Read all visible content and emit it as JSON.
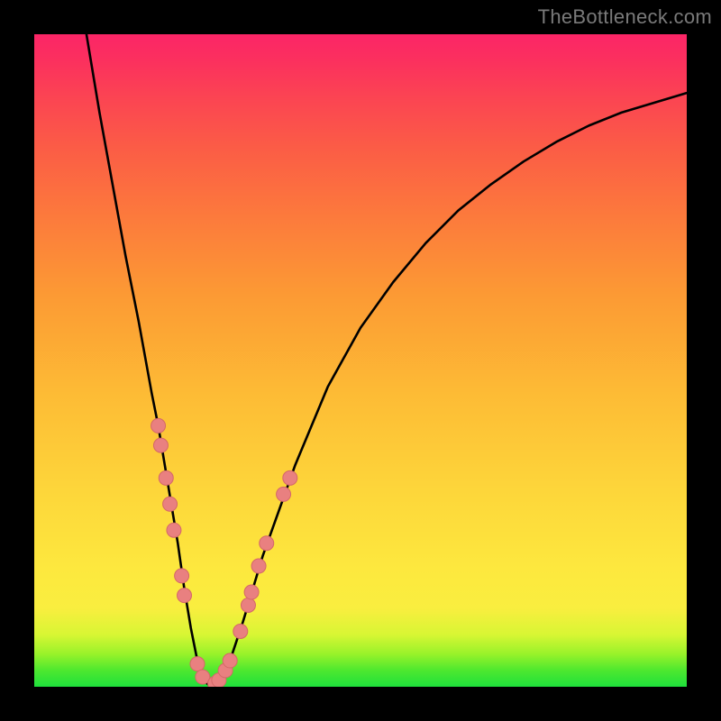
{
  "watermark": "TheBottleneck.com",
  "colors": {
    "frame": "#000000",
    "curve": "#000000",
    "dot_fill": "#e98080",
    "dot_stroke": "#d46868"
  },
  "chart_data": {
    "type": "line",
    "title": "",
    "xlabel": "",
    "ylabel": "",
    "xlim": [
      0,
      100
    ],
    "ylim": [
      0,
      100
    ],
    "series": [
      {
        "name": "curve",
        "x": [
          8,
          10,
          12,
          14,
          16,
          18,
          19,
          20,
          21,
          22,
          23,
          24,
          25,
          26,
          27,
          28,
          30,
          32,
          35,
          40,
          45,
          50,
          55,
          60,
          65,
          70,
          75,
          80,
          85,
          90,
          95,
          100
        ],
        "values": [
          100,
          88,
          77,
          66,
          56,
          45,
          40,
          34,
          28,
          22,
          15,
          9,
          4,
          1,
          0,
          0.5,
          4,
          10,
          20,
          34,
          46,
          55,
          62,
          68,
          73,
          77,
          80.5,
          83.5,
          86,
          88,
          89.5,
          91
        ]
      }
    ],
    "points": [
      {
        "x": 19.0,
        "y": 40
      },
      {
        "x": 19.4,
        "y": 37
      },
      {
        "x": 20.2,
        "y": 32
      },
      {
        "x": 20.8,
        "y": 28
      },
      {
        "x": 21.4,
        "y": 24
      },
      {
        "x": 22.6,
        "y": 17
      },
      {
        "x": 23.0,
        "y": 14
      },
      {
        "x": 25.0,
        "y": 3.5
      },
      {
        "x": 25.8,
        "y": 1.5
      },
      {
        "x": 27.7,
        "y": 0.5
      },
      {
        "x": 28.3,
        "y": 1.0
      },
      {
        "x": 29.3,
        "y": 2.5
      },
      {
        "x": 30.0,
        "y": 4.0
      },
      {
        "x": 31.6,
        "y": 8.5
      },
      {
        "x": 32.8,
        "y": 12.5
      },
      {
        "x": 33.3,
        "y": 14.5
      },
      {
        "x": 34.4,
        "y": 18.5
      },
      {
        "x": 35.6,
        "y": 22.0
      },
      {
        "x": 38.2,
        "y": 29.5
      },
      {
        "x": 39.2,
        "y": 32.0
      }
    ],
    "dot_radius_px": 8
  }
}
